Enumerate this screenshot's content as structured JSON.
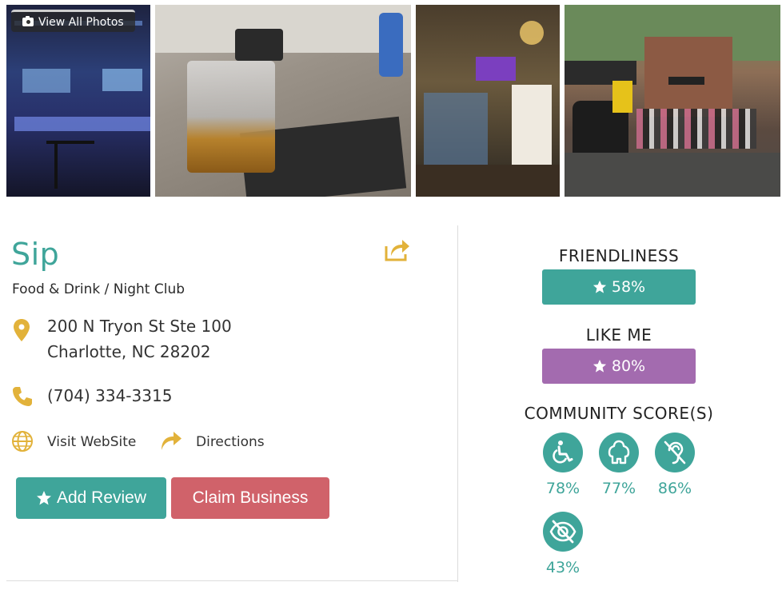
{
  "photos": {
    "view_all_label": "View All Photos"
  },
  "business": {
    "name": "Sip",
    "category": "Food & Drink / Night Club",
    "address_line1": "200 N Tryon St Ste 100",
    "address_line2": "Charlotte, NC 28202",
    "phone": "(704) 334-3315",
    "website_label": "Visit WebSite",
    "directions_label": "Directions"
  },
  "actions": {
    "add_review_label": "Add Review",
    "claim_business_label": "Claim Business"
  },
  "scores": {
    "friendliness": {
      "title": "FRIENDLINESS",
      "value": "58%",
      "color": "#3fa59a"
    },
    "like_me": {
      "title": "LIKE ME",
      "value": "80%",
      "color": "#a36baf"
    },
    "community_title": "COMMUNITY SCORE(S)",
    "community": [
      {
        "icon": "wheelchair-icon",
        "value": "78%"
      },
      {
        "icon": "person-icon",
        "value": "77%"
      },
      {
        "icon": "deaf-icon",
        "value": "86%"
      },
      {
        "icon": "eye-slash-icon",
        "value": "43%"
      }
    ]
  },
  "colors": {
    "accent_teal": "#3fa59a",
    "accent_purple": "#a36baf",
    "claim_red": "#d0626a",
    "icon_gold": "#e2b23a"
  }
}
